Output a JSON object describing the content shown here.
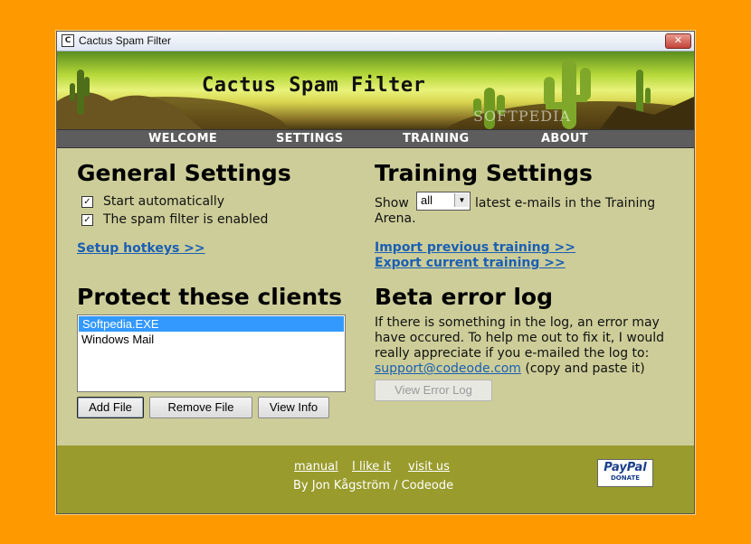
{
  "window": {
    "title": "Cactus Spam Filter",
    "close_glyph": "✕"
  },
  "banner": {
    "title": "Cactus Spam Filter",
    "watermark": "SOFTPEDIA"
  },
  "nav": {
    "items": [
      {
        "label": "WELCOME"
      },
      {
        "label": "SETTINGS"
      },
      {
        "label": "TRAINING"
      },
      {
        "label": "ABOUT"
      }
    ]
  },
  "general": {
    "heading": "General Settings",
    "checkboxes": [
      {
        "label": "Start automatically",
        "checked": true
      },
      {
        "label": "The spam filter is enabled",
        "checked": true
      }
    ],
    "hotkeys_link": "Setup hotkeys >>"
  },
  "training": {
    "heading": "Training Settings",
    "show_prefix": "Show",
    "show_value": "all",
    "show_suffix_line1": "latest e-mails in the Training",
    "show_suffix_line2": "Arena.",
    "import_link": "Import previous training >>",
    "export_link": "Export current training >>"
  },
  "clients": {
    "heading": "Protect these clients",
    "items": [
      {
        "label": "Softpedia.EXE",
        "selected": true
      },
      {
        "label": "Windows Mail",
        "selected": false
      }
    ],
    "add_button": "Add File",
    "remove_button": "Remove File",
    "view_button": "View Info"
  },
  "beta": {
    "heading": "Beta error log",
    "line1": "If there is something in the log, an error may",
    "line2": "have occured. To help me out to fix it, I would",
    "line3": "really appreciate if you e-mailed the log to:",
    "email": "support@codeode.com",
    "email_suffix": "(copy and paste it)",
    "view_button": "View Error Log"
  },
  "footer": {
    "manual": "manual",
    "like": "I like it",
    "visit": "visit us",
    "credit": "By Jon Kågström / Codeode",
    "paypal_logo": "PayPal",
    "paypal_donate": "DONATE"
  },
  "colors": {
    "desktop": "#ff9900",
    "window_bg": "#cdcd99",
    "nav_bg": "#5d5d5d",
    "footer_bg": "#999b2c",
    "link": "#1a5fb4",
    "selection": "#3399ff"
  },
  "icons": [
    "app-icon",
    "close-icon",
    "checkbox-checked-icon",
    "dropdown-arrow-icon",
    "cactus-illustration"
  ]
}
